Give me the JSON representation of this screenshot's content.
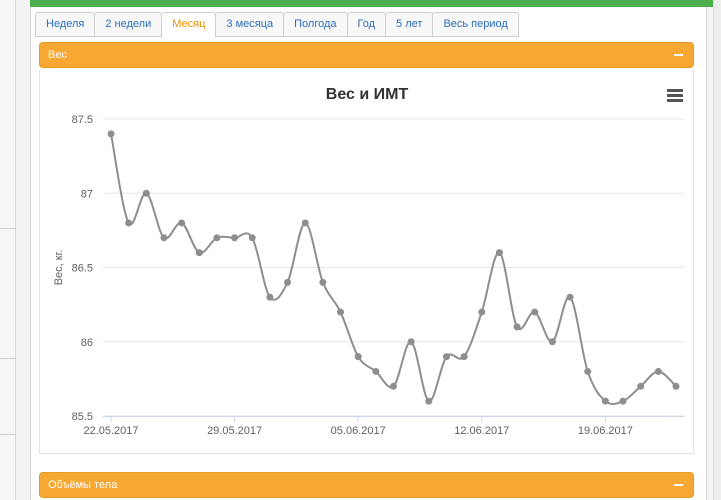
{
  "tabs": [
    {
      "label": "Неделя",
      "active": false
    },
    {
      "label": "2 недели",
      "active": false
    },
    {
      "label": "Месяц",
      "active": true
    },
    {
      "label": "3 месяца",
      "active": false
    },
    {
      "label": "Полгода",
      "active": false
    },
    {
      "label": "Год",
      "active": false
    },
    {
      "label": "5 лет",
      "active": false
    },
    {
      "label": "Весь период",
      "active": false
    }
  ],
  "weight_panel": {
    "title": "Вес"
  },
  "body_panel": {
    "title": "Объёмы тела"
  },
  "colors": {
    "accent": "#f7a833",
    "active_tab": "#e69200",
    "link": "#2a6ebb",
    "series": "#8e8e8e",
    "top_bar": "#4cae4c"
  },
  "icons": {
    "menu": "hamburger-menu-icon",
    "collapse": "minus-icon"
  },
  "chart_data": {
    "type": "line",
    "title": "Вес и ИМТ",
    "xlabel": "",
    "ylabel": "Вес, кг.",
    "ylim": [
      85.5,
      87.5
    ],
    "yticks": [
      85.5,
      86,
      86.5,
      87,
      87.5
    ],
    "xtick_labels": [
      "22.05.2017",
      "29.05.2017",
      "05.06.2017",
      "12.06.2017",
      "19.06.2017"
    ],
    "grid": true,
    "legend": "none",
    "x": [
      "22.05.2017",
      "23.05.2017",
      "24.05.2017",
      "25.05.2017",
      "26.05.2017",
      "27.05.2017",
      "28.05.2017",
      "29.05.2017",
      "30.05.2017",
      "31.05.2017",
      "01.06.2017",
      "02.06.2017",
      "03.06.2017",
      "04.06.2017",
      "05.06.2017",
      "06.06.2017",
      "07.06.2017",
      "08.06.2017",
      "09.06.2017",
      "10.06.2017",
      "11.06.2017",
      "12.06.2017",
      "13.06.2017",
      "14.06.2017",
      "15.06.2017",
      "16.06.2017",
      "17.06.2017",
      "18.06.2017",
      "19.06.2017",
      "20.06.2017",
      "21.06.2017",
      "22.06.2017",
      "23.06.2017"
    ],
    "series": [
      {
        "values": [
          87.4,
          86.8,
          87.0,
          86.7,
          86.8,
          86.6,
          86.7,
          86.7,
          86.7,
          86.3,
          86.4,
          86.8,
          86.4,
          86.2,
          85.9,
          85.8,
          85.7,
          86.0,
          85.6,
          85.9,
          85.9,
          86.2,
          86.6,
          86.1,
          86.2,
          86.0,
          86.3,
          85.8,
          85.6,
          85.6,
          85.7,
          85.8,
          85.7
        ]
      }
    ]
  }
}
